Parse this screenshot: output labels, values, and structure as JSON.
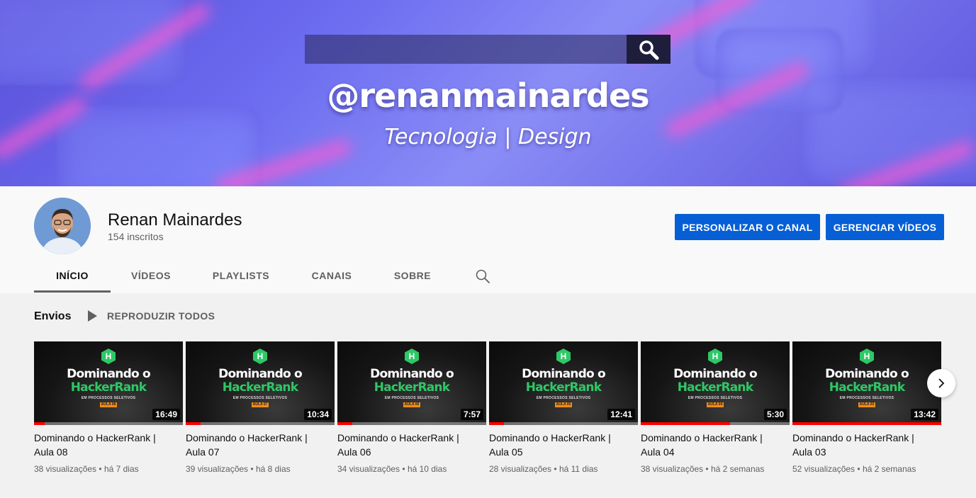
{
  "banner": {
    "handle": "@renanmainardes",
    "tagline": "Tecnologia | Design"
  },
  "channel": {
    "name": "Renan Mainardes",
    "subscribers": "154 inscritos",
    "customize_label": "PERSONALIZAR O CANAL",
    "manage_label": "GERENCIAR VÍDEOS"
  },
  "tabs": [
    {
      "label": "INÍCIO",
      "active": true
    },
    {
      "label": "VÍDEOS",
      "active": false
    },
    {
      "label": "PLAYLISTS",
      "active": false
    },
    {
      "label": "CANAIS",
      "active": false
    },
    {
      "label": "SOBRE",
      "active": false
    }
  ],
  "shelf": {
    "title": "Envios",
    "play_all_label": "REPRODUZIR TODOS"
  },
  "thumbnail_text": {
    "logo": "H",
    "line1": "Dominando o",
    "line2": "HackerRank",
    "subtitle": "EM PROCESSOS SELETIVOS"
  },
  "videos": [
    {
      "title": "Dominando o HackerRank | Aula 08",
      "duration": "16:49",
      "views": "38 visualizações",
      "age": "há 7 dias",
      "tag": "AULA 08",
      "watched": 0.07
    },
    {
      "title": "Dominando o HackerRank | Aula 07",
      "duration": "10:34",
      "views": "39 visualizações",
      "age": "há 8 dias",
      "tag": "AULA 07",
      "watched": 0.1
    },
    {
      "title": "Dominando o HackerRank | Aula 06",
      "duration": "7:57",
      "views": "34 visualizações",
      "age": "há 10 dias",
      "tag": "AULA 06",
      "watched": 0.1
    },
    {
      "title": "Dominando o HackerRank | Aula 05",
      "duration": "12:41",
      "views": "28 visualizações",
      "age": "há 11 dias",
      "tag": "AULA 05",
      "watched": 0.1
    },
    {
      "title": "Dominando o HackerRank | Aula 04",
      "duration": "5:30",
      "views": "38 visualizações",
      "age": "há 2 semanas",
      "tag": "AULA 04",
      "watched": 0.6
    },
    {
      "title": "Dominando o HackerRank | Aula 03",
      "duration": "13:42",
      "views": "52 visualizações",
      "age": "há 2 semanas",
      "tag": "AULA 03",
      "watched": 1.0
    }
  ],
  "icons": {
    "banner_search": "search-icon",
    "tab_search": "search-icon",
    "play_all": "play-icon",
    "next": "chevron-right-icon"
  },
  "colors": {
    "primary_button": "#065fd4",
    "progress": "#ff0000",
    "hackerrank_green": "#2ec866"
  }
}
